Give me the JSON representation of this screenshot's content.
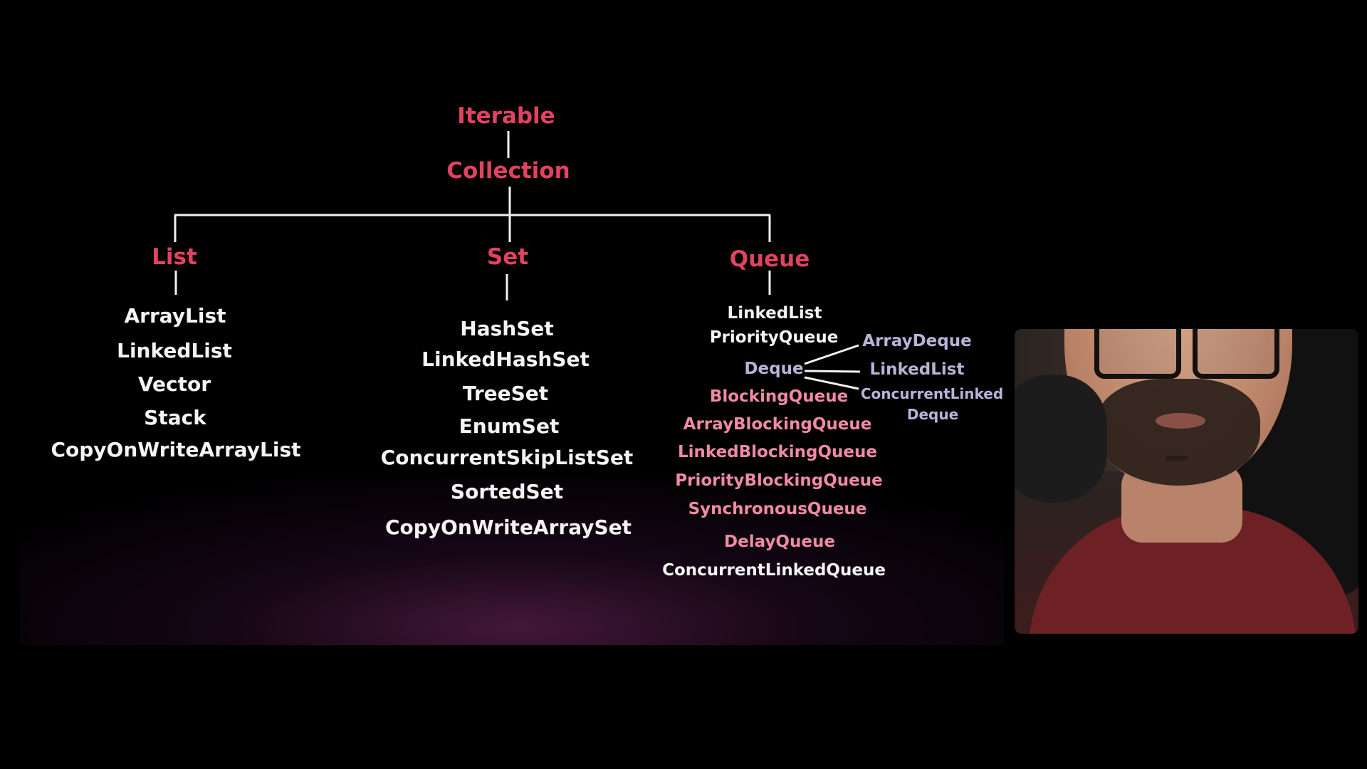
{
  "diagram": {
    "root": "Iterable",
    "collection": "Collection",
    "list": {
      "label": "List",
      "items": [
        "ArrayList",
        "LinkedList",
        "Vector",
        "Stack",
        "CopyOnWriteArrayList"
      ]
    },
    "set": {
      "label": "Set",
      "items": [
        "HashSet",
        "LinkedHashSet",
        "TreeSet",
        "EnumSet",
        "ConcurrentSkipListSet",
        "SortedSet",
        "CopyOnWriteArraySet"
      ]
    },
    "queue": {
      "label": "Queue",
      "items_top": [
        "LinkedList",
        "PriorityQueue"
      ],
      "deque": {
        "label": "Deque",
        "children": [
          "ArrayDeque",
          "LinkedList",
          "ConcurrentLinked",
          "Deque"
        ]
      },
      "blocking": [
        "BlockingQueue",
        "ArrayBlockingQueue",
        "LinkedBlockingQueue",
        "PriorityBlockingQueue",
        "SynchronousQueue",
        "DelayQueue"
      ],
      "last": "ConcurrentLinkedQueue"
    }
  },
  "colors": {
    "accent_red": "#e0435f",
    "pink": "#f08aa6",
    "lavender": "#b8b4d8",
    "text_white": "#f4f4f4",
    "background": "#000000"
  }
}
